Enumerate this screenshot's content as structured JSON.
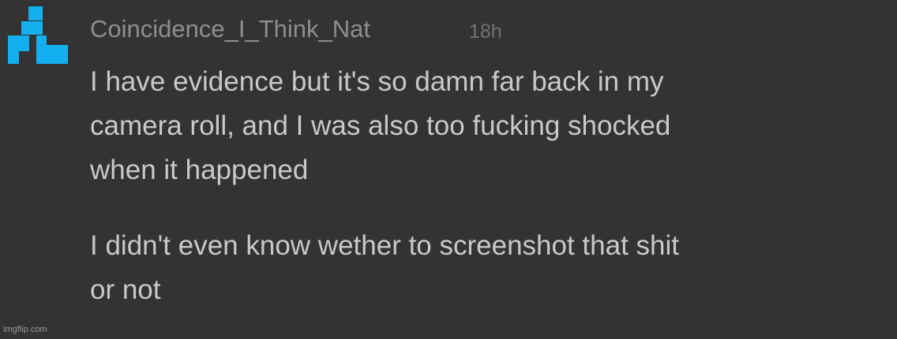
{
  "comment": {
    "avatar": {
      "icon": "pixel-avatar-icon",
      "color": "#14AFEE"
    },
    "username": "Coincidence_I_Think_Nat",
    "timestamp": "18h",
    "paragraphs": [
      {
        "lines": [
          "I have evidence but it's so damn far back in my",
          "camera roll, and I was also too fucking shocked",
          "when it happened"
        ]
      },
      {
        "lines": [
          "I didn't even know wether to screenshot that shit",
          "or not"
        ]
      }
    ]
  },
  "watermark": "imgflip.com"
}
